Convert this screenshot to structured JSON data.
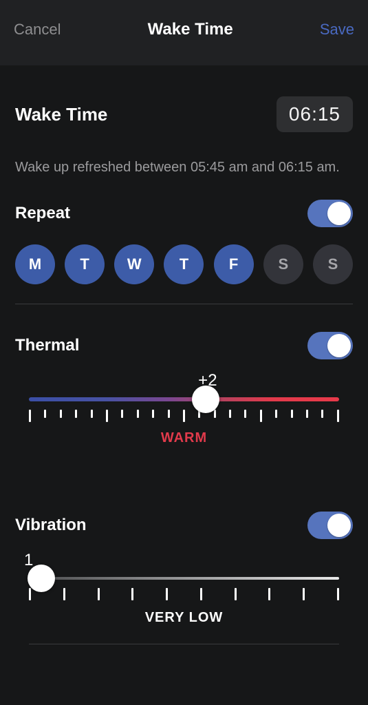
{
  "header": {
    "cancel": "Cancel",
    "title": "Wake Time",
    "save": "Save"
  },
  "wake": {
    "label": "Wake Time",
    "time": "06:15",
    "subtext": "Wake up refreshed between 05:45 am and 06:15 am."
  },
  "repeat": {
    "label": "Repeat",
    "toggle_on": true,
    "days": [
      {
        "label": "M",
        "active": true
      },
      {
        "label": "T",
        "active": true
      },
      {
        "label": "W",
        "active": true
      },
      {
        "label": "T",
        "active": true
      },
      {
        "label": "F",
        "active": true
      },
      {
        "label": "S",
        "active": false
      },
      {
        "label": "S",
        "active": false
      }
    ]
  },
  "thermal": {
    "label": "Thermal",
    "toggle_on": true,
    "value_text": "+2",
    "value": 2,
    "min": -10,
    "max": 10,
    "category_label": "WARM",
    "thumb_percent": 57
  },
  "vibration": {
    "label": "Vibration",
    "toggle_on": true,
    "value_text": "1",
    "value": 1,
    "min": 1,
    "max": 10,
    "category_label": "VERY LOW",
    "thumb_percent": 4
  }
}
